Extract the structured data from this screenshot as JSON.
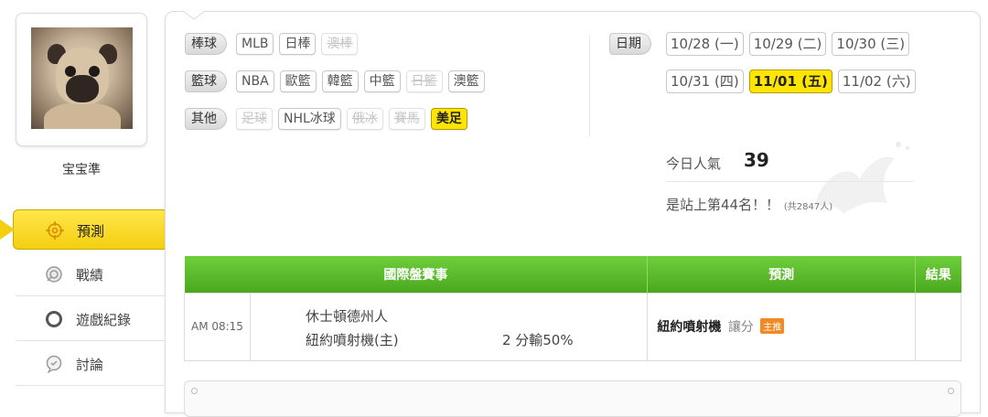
{
  "user": {
    "name": "宝宝準"
  },
  "nav": {
    "active": {
      "label": "預測",
      "icon": "target-icon"
    },
    "items": [
      {
        "label": "戰績",
        "icon": "chart-icon"
      },
      {
        "label": "遊戲紀錄",
        "icon": "record-icon"
      },
      {
        "label": "討論",
        "icon": "chat-icon"
      }
    ]
  },
  "sports": {
    "baseball": {
      "label": "棒球",
      "tags": [
        "MLB",
        "日棒",
        "澳棒"
      ]
    },
    "basketball": {
      "label": "籃球",
      "tags": [
        "NBA",
        "歐籃",
        "韓籃",
        "中籃",
        "日籃",
        "澳籃"
      ]
    },
    "other": {
      "label": "其他",
      "tags": [
        "足球",
        "NHL冰球",
        "俄冰",
        "賽馬",
        "美足"
      ]
    }
  },
  "dates": {
    "label": "日期",
    "row1": [
      "10/28 (一)",
      "10/29 (二)",
      "10/30 (三)"
    ],
    "row2": [
      "10/31 (四)",
      "11/01 (五)",
      "11/02 (六)"
    ],
    "selected": "11/01 (五)"
  },
  "stats": {
    "popularity_label": "今日人氣",
    "popularity_value": "39",
    "rank_text": "是站上第44名！！",
    "rank_sub": "(共2847人)"
  },
  "table": {
    "headers": [
      "國際盤賽事",
      "預測",
      "結果"
    ],
    "rows": [
      {
        "time": "AM 08:15",
        "away": "休士頓德州人",
        "home": "紐約噴射機(主)",
        "handicap": "2 分輸50%",
        "pick": "紐約噴射機",
        "pick_type": "讓分",
        "badge": "主推",
        "result": ""
      }
    ]
  },
  "colors": {
    "accent_yellow": "#ffe500",
    "header_green": "#5bbc2c",
    "badge_orange": "#f08a24"
  }
}
